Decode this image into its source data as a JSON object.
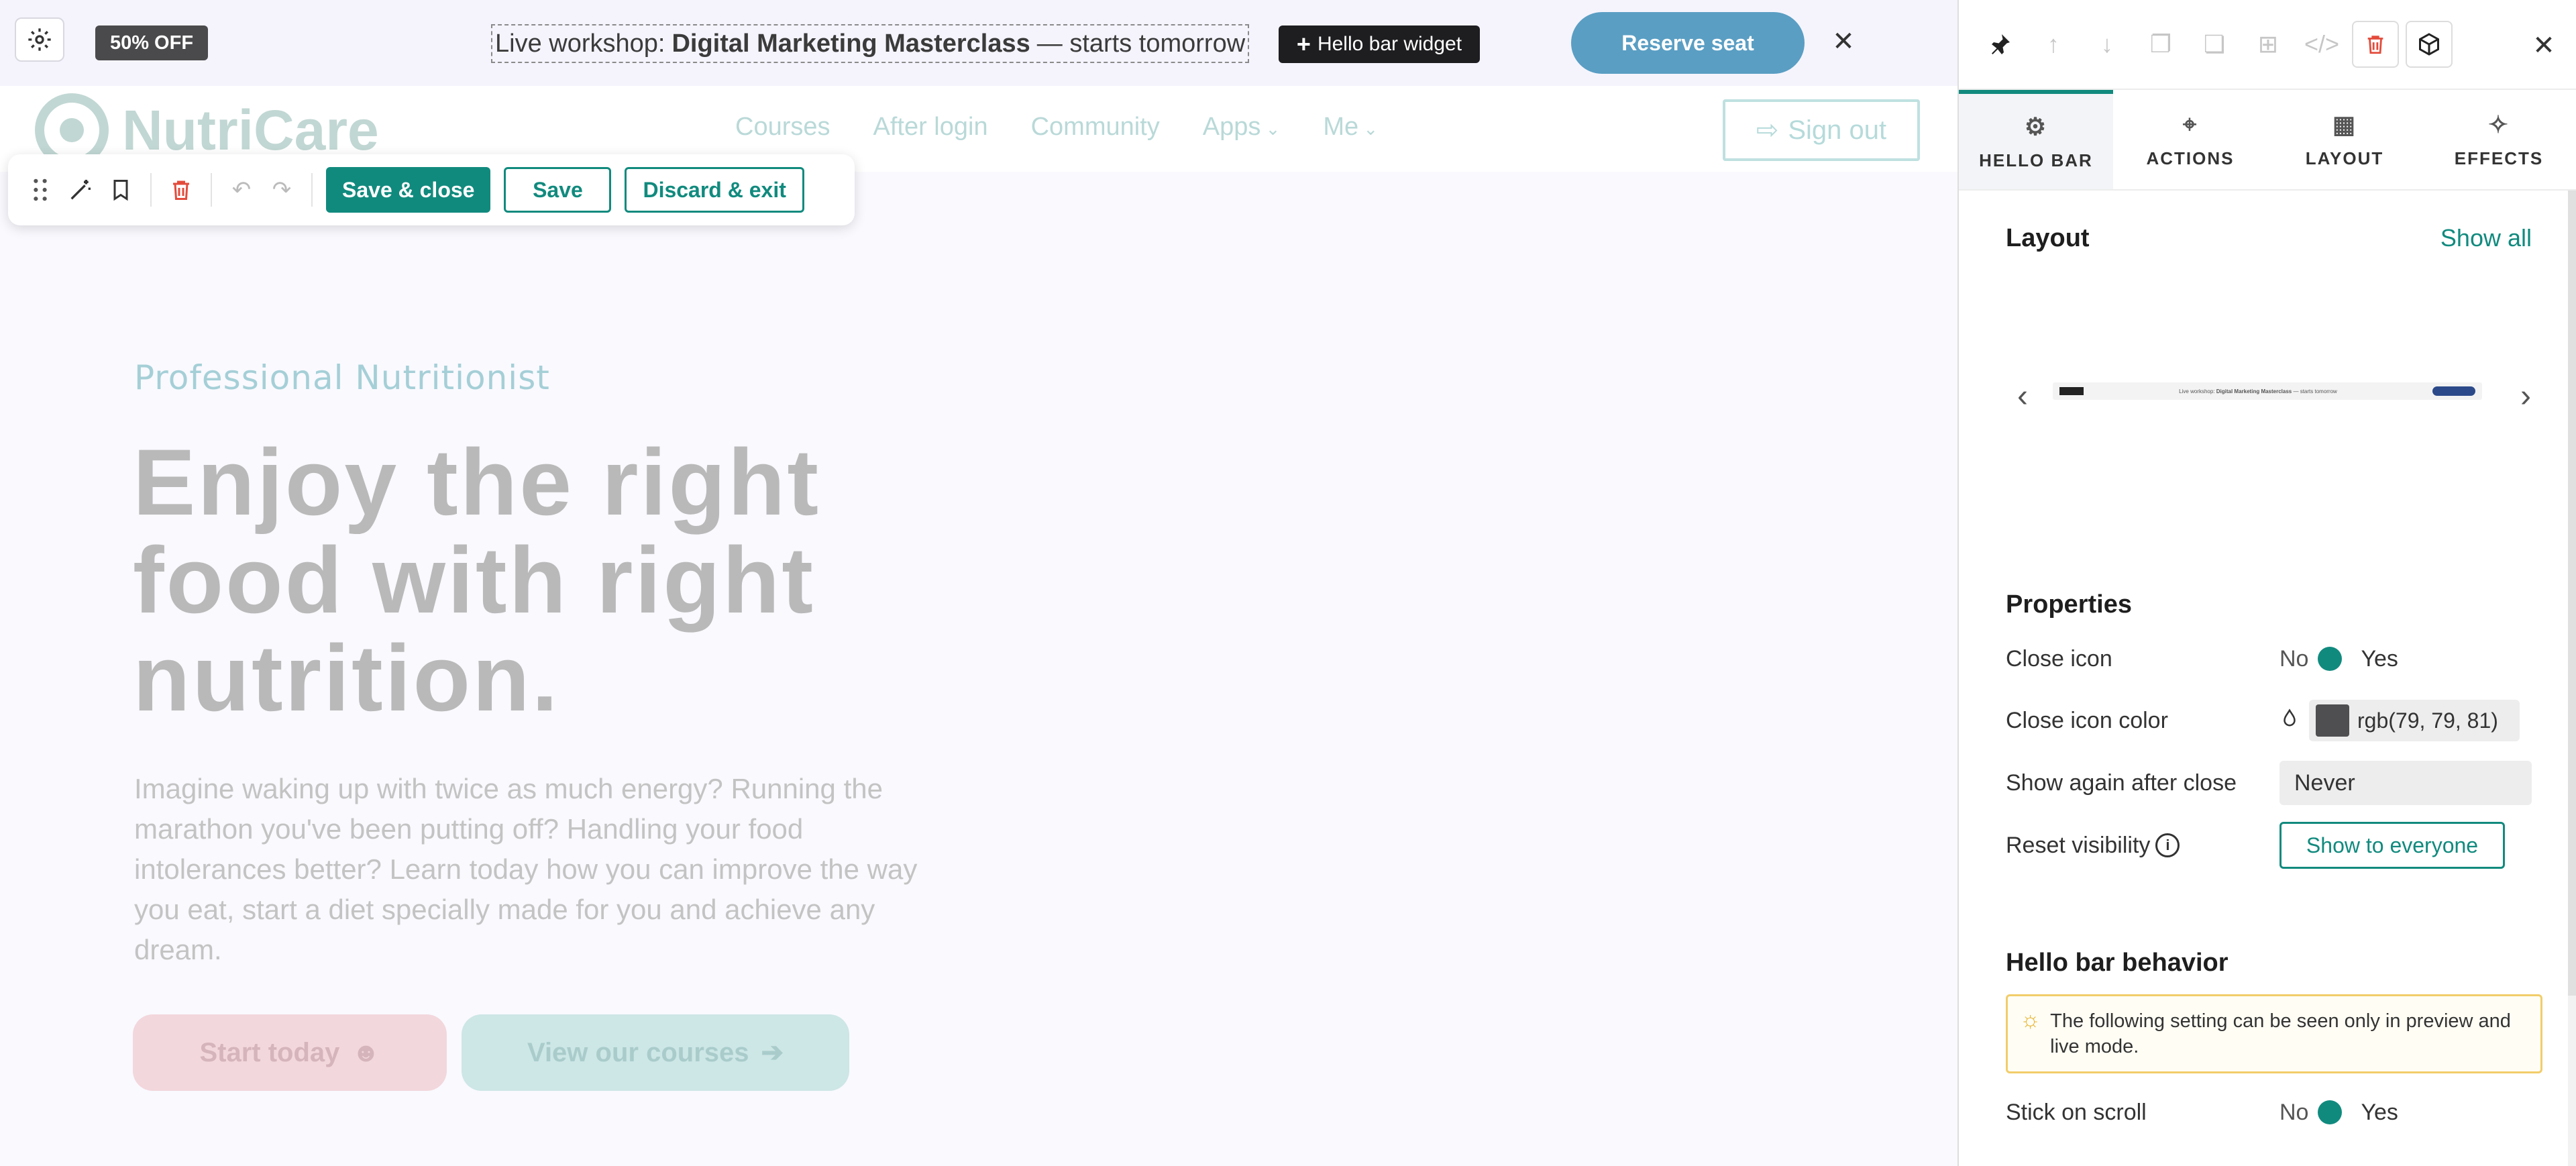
{
  "hello_bar": {
    "badge": "50% OFF",
    "text_prefix": "Live workshop:",
    "text_bold": "Digital Marketing Masterclass",
    "text_suffix": "— starts tomorrow",
    "widget_tag": "Hello bar widget",
    "widget_tag_icon": "plus-icon",
    "cta": "Reserve seat",
    "close_icon": "close-icon",
    "bg_color": "#f5f4fd",
    "cta_color": "#5a9ec3"
  },
  "site": {
    "logo": "NutriCare",
    "nav": [
      "Courses",
      "After login",
      "Community",
      "Apps",
      "Me"
    ],
    "sign_out": "Sign out",
    "hero": {
      "subtitle": "Professional Nutritionist",
      "title": "Enjoy the right food with right nutrition.",
      "body": "Imagine waking up with twice as much energy? Running the marathon you've been putting off? Handling your food intolerances better? Learn today how you can improve the way you eat, start a diet specially made for you and achieve any dream.",
      "btn_start": "Start today",
      "btn_courses": "View our courses"
    }
  },
  "editor_toolbar": {
    "save_close": "Save & close",
    "save": "Save",
    "discard": "Discard & exit",
    "accent": "#118a7e"
  },
  "panel": {
    "tabs": [
      {
        "label": "HELLO BAR",
        "icon": "gear-icon"
      },
      {
        "label": "ACTIONS",
        "icon": "cursor-click-icon"
      },
      {
        "label": "LAYOUT",
        "icon": "grid-icon"
      },
      {
        "label": "EFFECTS",
        "icon": "sparkle-icon"
      }
    ],
    "layout": {
      "title": "Layout",
      "show_all": "Show all"
    },
    "properties": {
      "title": "Properties",
      "close_icon_label": "Close icon",
      "close_icon_no": "No",
      "close_icon_yes": "Yes",
      "close_icon_color_label": "Close icon color",
      "close_icon_color_value": "rgb(79, 79, 81)",
      "show_again_label": "Show again after close",
      "show_again_value": "Never",
      "reset_label": "Reset visibility",
      "reset_button": "Show to everyone"
    },
    "behavior": {
      "title": "Hello bar behavior",
      "notice": "The following setting can be seen only in preview and live mode.",
      "stick_label": "Stick on scroll",
      "stick_no": "No",
      "stick_yes": "Yes"
    }
  }
}
